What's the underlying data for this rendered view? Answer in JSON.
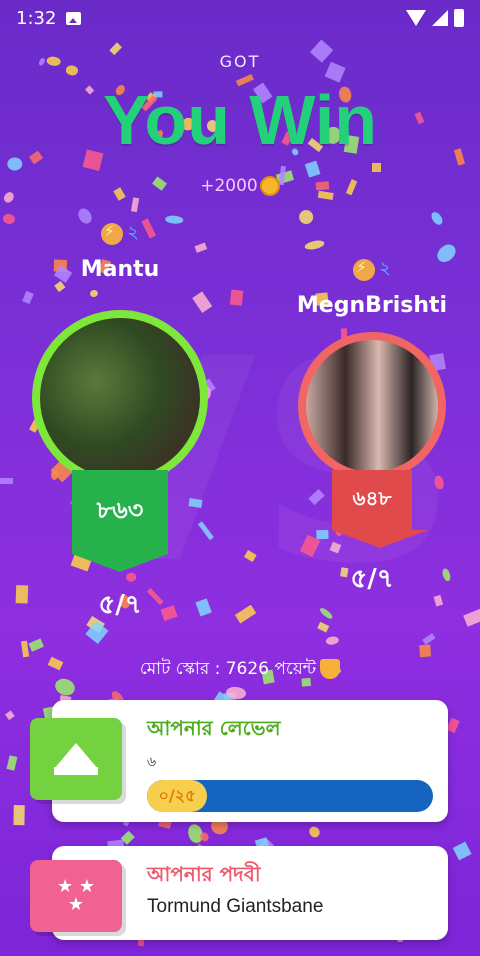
{
  "status_bar": {
    "time": "1:32"
  },
  "header": {
    "got_label": "GOT",
    "title": "You Win",
    "reward": "+2000"
  },
  "players": [
    {
      "name": "Mantu",
      "level_badge": "২",
      "score": "৮৬৩",
      "correct": "৫/৭",
      "ring_color": "#7ee83a",
      "ribbon_color": "#26b14b"
    },
    {
      "name": "MegnBrishti",
      "level_badge": "২",
      "score": "৬৪৮",
      "correct": "৫/৭",
      "ring_color": "#f26565",
      "ribbon_color": "#e04a4a"
    }
  ],
  "total_score": "মোট স্কোর : 7626 পয়েন্ট",
  "level_card": {
    "title": "আপনার লেভেল",
    "level_value": "৬",
    "progress_text": "০/২৫",
    "progress_fraction": 0,
    "accent": "#74d13f"
  },
  "rank_card": {
    "title": "আপনার পদবী",
    "rank_name": "Tormund Giantsbane",
    "accent": "#f06292"
  },
  "icons": {
    "crown": "crown-icon",
    "stars": "stars-icon",
    "coin": "coin-icon",
    "trophy": "trophy-icon",
    "bolt": "bolt-icon"
  }
}
